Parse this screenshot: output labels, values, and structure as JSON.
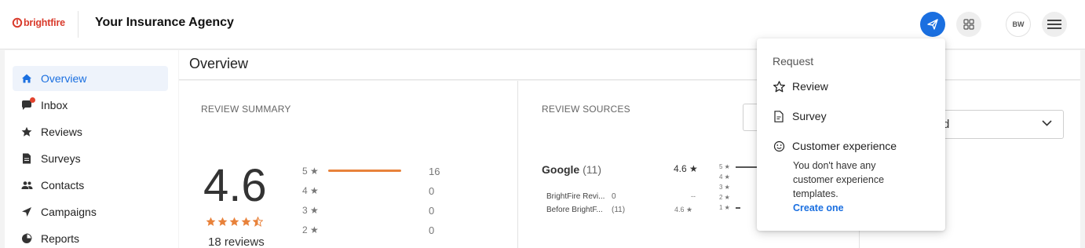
{
  "header": {
    "logo_text": "brightfire",
    "agency_name": "Your Insurance Agency",
    "avatar_initials": "BW"
  },
  "sidebar": {
    "items": [
      {
        "label": "Overview",
        "icon": "home-icon",
        "active": true
      },
      {
        "label": "Inbox",
        "icon": "chat-icon",
        "badge": true
      },
      {
        "label": "Reviews",
        "icon": "star-icon"
      },
      {
        "label": "Surveys",
        "icon": "document-icon"
      },
      {
        "label": "Contacts",
        "icon": "people-icon"
      },
      {
        "label": "Campaigns",
        "icon": "send-icon"
      },
      {
        "label": "Reports",
        "icon": "pie-chart-icon"
      }
    ]
  },
  "main": {
    "title": "Overview",
    "summary": {
      "section_title": "REVIEW SUMMARY",
      "rating": "4.6",
      "stars": 4.6,
      "review_count": "18 reviews",
      "distribution": [
        {
          "label": "5 ★",
          "count": "16",
          "fraction": 0.89
        },
        {
          "label": "4 ★",
          "count": "0",
          "fraction": 0
        },
        {
          "label": "3 ★",
          "count": "0",
          "fraction": 0
        },
        {
          "label": "2 ★",
          "count": "0",
          "fraction": 0
        }
      ]
    },
    "sources": {
      "section_title": "REVIEW SOURCES",
      "google": {
        "name": "Google",
        "count": "(11)",
        "rating": "4.6 ★"
      },
      "mini_distribution": [
        "5 ★",
        "4 ★",
        "3 ★",
        "2 ★",
        "1 ★"
      ],
      "rows": [
        {
          "name": "BrightFire Revi...",
          "count": "0",
          "rating": "--"
        },
        {
          "name": "Before BrightF...",
          "count": "(11)",
          "rating": "4.6 ★"
        }
      ]
    },
    "right_select": {
      "value_fragment": "d"
    }
  },
  "request_menu": {
    "title": "Request",
    "items": [
      {
        "label": "Review",
        "icon": "star-outline-icon"
      },
      {
        "label": "Survey",
        "icon": "document-outline-icon"
      },
      {
        "label": "Customer experience",
        "icon": "smiley-icon"
      }
    ],
    "cx_description": "You don't have any customer experience templates.",
    "cx_link": "Create one"
  },
  "colors": {
    "accent_blue": "#1a6fe0",
    "star_orange": "#e8823b",
    "brand_red": "#d93b2c"
  }
}
